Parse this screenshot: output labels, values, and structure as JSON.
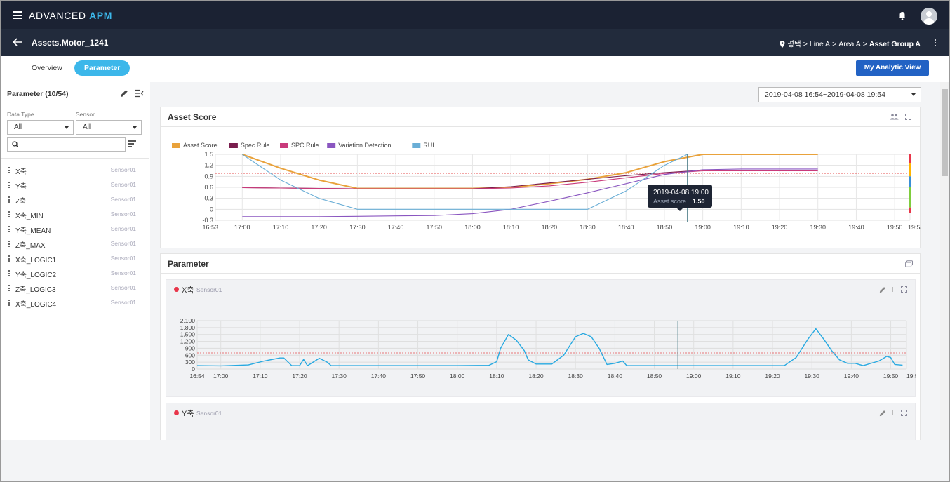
{
  "app": {
    "brand_main": "ADVANCED",
    "brand_accent": "APM",
    "accent_color": "#3cb7ea"
  },
  "header": {
    "asset_title": "Assets.Motor_1241",
    "breadcrumb": [
      "평택",
      "Line A",
      "Area A",
      "Asset Group A"
    ]
  },
  "tabs": {
    "overview": "Overview",
    "parameter": "Parameter",
    "active": "parameter"
  },
  "my_view_button": "My Analytic View",
  "sidebar": {
    "title": "Parameter (10/54)",
    "data_type_label": "Data Type",
    "data_type_value": "All",
    "sensor_label": "Sensor",
    "sensor_value": "All",
    "search_placeholder": "",
    "items": [
      {
        "name": "X축",
        "sensor": "Sensor01"
      },
      {
        "name": "Y축",
        "sensor": "Sensor01"
      },
      {
        "name": "Z축",
        "sensor": "Sensor01"
      },
      {
        "name": "X축_MIN",
        "sensor": "Sensor01"
      },
      {
        "name": "Y축_MEAN",
        "sensor": "Sensor01"
      },
      {
        "name": "Z축_MAX",
        "sensor": "Sensor01"
      },
      {
        "name": "X축_LOGIC1",
        "sensor": "Sensor01"
      },
      {
        "name": "Y축_LOGIC2",
        "sensor": "Sensor01"
      },
      {
        "name": "Z축_LOGIC3",
        "sensor": "Sensor01"
      },
      {
        "name": "X축_LOGIC4",
        "sensor": "Sensor01"
      }
    ]
  },
  "date_range": "2019-04-08 16:54~2019-04-08 19:54",
  "asset_score_panel": {
    "title": "Asset Score"
  },
  "parameter_panel": {
    "title": "Parameter",
    "cards": [
      {
        "name": "X축",
        "sensor": "Sensor01"
      },
      {
        "name": "Y축",
        "sensor": "Sensor01"
      }
    ]
  },
  "tooltip": {
    "time": "2019-04-08 19:00",
    "label": "Asset score",
    "value": "1.50"
  },
  "chart_data": [
    {
      "type": "line",
      "title": "Asset Score",
      "x": [
        "16:53",
        "17:00",
        "17:10",
        "17:20",
        "17:30",
        "17:40",
        "17:50",
        "18:00",
        "18:10",
        "18:20",
        "18:30",
        "18:40",
        "18:50",
        "19:00",
        "19:10",
        "19:20",
        "19:30",
        "19:40",
        "19:50",
        "19:54"
      ],
      "x_ticks": [
        "16:53",
        "17:00",
        "17:10",
        "17:20",
        "17:30",
        "17:40",
        "17:50",
        "18:00",
        "18:10",
        "18:20",
        "18:30",
        "18:40",
        "18:50",
        "19:00",
        "19:10",
        "19:20",
        "19:30",
        "19:40",
        "19:50",
        "19:54"
      ],
      "y_ticks": [
        "1.5",
        "1.2",
        "0.9",
        "0.6",
        "0.3",
        "0",
        "-0.3"
      ],
      "ylim": [
        -0.3,
        1.5
      ],
      "threshold": 0.98,
      "cursor_time": "18:56",
      "series": [
        {
          "name": "Asset Score",
          "color": "#e9a23b",
          "points": [
            [
              "17:00",
              1.5
            ],
            [
              "17:10",
              1.12
            ],
            [
              "17:20",
              0.8
            ],
            [
              "17:30",
              0.57
            ],
            [
              "17:40",
              0.57
            ],
            [
              "17:50",
              0.57
            ],
            [
              "18:00",
              0.57
            ],
            [
              "18:10",
              0.6
            ],
            [
              "18:20",
              0.7
            ],
            [
              "18:30",
              0.82
            ],
            [
              "18:40",
              1.0
            ],
            [
              "18:50",
              1.3
            ],
            [
              "19:00",
              1.5
            ],
            [
              "19:10",
              1.5
            ],
            [
              "19:20",
              1.5
            ],
            [
              "19:30",
              1.5
            ]
          ]
        },
        {
          "name": "Spec Rule",
          "color": "#7a1e4e",
          "points": [
            [
              "17:00",
              0.59
            ],
            [
              "17:10",
              0.58
            ],
            [
              "17:20",
              0.57
            ],
            [
              "17:30",
              0.56
            ],
            [
              "17:40",
              0.56
            ],
            [
              "17:50",
              0.56
            ],
            [
              "18:00",
              0.56
            ],
            [
              "18:10",
              0.62
            ],
            [
              "18:20",
              0.72
            ],
            [
              "18:30",
              0.82
            ],
            [
              "18:40",
              0.92
            ],
            [
              "18:50",
              1.0
            ],
            [
              "19:00",
              1.07
            ],
            [
              "19:10",
              1.07
            ],
            [
              "19:20",
              1.07
            ],
            [
              "19:30",
              1.07
            ]
          ]
        },
        {
          "name": "SPC Rule",
          "color": "#c93a7b",
          "points": [
            [
              "17:00",
              0.59
            ],
            [
              "17:10",
              0.58
            ],
            [
              "17:20",
              0.57
            ],
            [
              "17:30",
              0.56
            ],
            [
              "17:40",
              0.56
            ],
            [
              "17:50",
              0.56
            ],
            [
              "18:00",
              0.56
            ],
            [
              "18:10",
              0.58
            ],
            [
              "18:20",
              0.64
            ],
            [
              "18:30",
              0.74
            ],
            [
              "18:40",
              0.86
            ],
            [
              "18:50",
              0.98
            ],
            [
              "19:00",
              1.05
            ],
            [
              "19:10",
              1.05
            ],
            [
              "19:20",
              1.05
            ],
            [
              "19:30",
              1.05
            ]
          ]
        },
        {
          "name": "Variation Detection",
          "color": "#8a56c0",
          "points": [
            [
              "17:00",
              -0.2
            ],
            [
              "17:10",
              -0.2
            ],
            [
              "17:20",
              -0.2
            ],
            [
              "17:30",
              -0.19
            ],
            [
              "17:40",
              -0.18
            ],
            [
              "17:50",
              -0.17
            ],
            [
              "18:00",
              -0.12
            ],
            [
              "18:10",
              0.0
            ],
            [
              "18:20",
              0.22
            ],
            [
              "18:30",
              0.45
            ],
            [
              "18:40",
              0.7
            ],
            [
              "18:50",
              0.95
            ],
            [
              "19:00",
              1.08
            ],
            [
              "19:10",
              1.1
            ],
            [
              "19:20",
              1.1
            ],
            [
              "19:30",
              1.1
            ]
          ]
        },
        {
          "name": "RUL",
          "color": "#6aaed6",
          "points": [
            [
              "17:00",
              1.5
            ],
            [
              "17:10",
              0.8
            ],
            [
              "17:20",
              0.3
            ],
            [
              "17:30",
              0.0
            ],
            [
              "17:40",
              0.0
            ],
            [
              "17:50",
              0.0
            ],
            [
              "18:00",
              0.0
            ],
            [
              "18:10",
              0.0
            ],
            [
              "18:20",
              0.0
            ],
            [
              "18:30",
              0.0
            ],
            [
              "18:40",
              0.5
            ],
            [
              "18:50",
              1.2
            ],
            [
              "18:56",
              1.5
            ]
          ]
        }
      ]
    },
    {
      "type": "line",
      "title": "X축",
      "x_ticks": [
        "16:54",
        "17:00",
        "17:10",
        "17:20",
        "17:30",
        "17:40",
        "17:50",
        "18:00",
        "18:10",
        "18:20",
        "18:30",
        "18:40",
        "18:50",
        "19:00",
        "19:10",
        "19:20",
        "19:30",
        "19:40",
        "19:50",
        "19:54"
      ],
      "y_ticks": [
        "2,100",
        "1,800",
        "1,500",
        "1,200",
        "900",
        "600",
        "300",
        "0"
      ],
      "ylim": [
        0,
        2100
      ],
      "threshold": 700,
      "cursor_time": "18:56",
      "series": [
        {
          "name": "X축",
          "color": "#27a9e1",
          "points": [
            [
              "16:54",
              150
            ],
            [
              "17:00",
              140
            ],
            [
              "17:07",
              180
            ],
            [
              "17:11",
              350
            ],
            [
              "17:15",
              480
            ],
            [
              "17:16",
              480
            ],
            [
              "17:18",
              150
            ],
            [
              "17:20",
              150
            ],
            [
              "17:21",
              420
            ],
            [
              "17:22",
              150
            ],
            [
              "17:25",
              470
            ],
            [
              "17:27",
              300
            ],
            [
              "17:28",
              150
            ],
            [
              "17:40",
              150
            ],
            [
              "17:55",
              150
            ],
            [
              "18:00",
              150
            ],
            [
              "18:08",
              160
            ],
            [
              "18:10",
              320
            ],
            [
              "18:11",
              900
            ],
            [
              "18:13",
              1500
            ],
            [
              "18:15",
              1250
            ],
            [
              "18:17",
              800
            ],
            [
              "18:18",
              400
            ],
            [
              "18:20",
              220
            ],
            [
              "18:24",
              220
            ],
            [
              "18:27",
              600
            ],
            [
              "18:30",
              1400
            ],
            [
              "18:32",
              1550
            ],
            [
              "18:34",
              1400
            ],
            [
              "18:36",
              900
            ],
            [
              "18:37",
              550
            ],
            [
              "18:38",
              200
            ],
            [
              "18:40",
              250
            ],
            [
              "18:42",
              350
            ],
            [
              "18:43",
              150
            ],
            [
              "18:50",
              150
            ],
            [
              "19:00",
              150
            ],
            [
              "19:10",
              150
            ],
            [
              "19:20",
              150
            ],
            [
              "19:23",
              150
            ],
            [
              "19:26",
              500
            ],
            [
              "19:29",
              1300
            ],
            [
              "19:31",
              1750
            ],
            [
              "19:33",
              1300
            ],
            [
              "19:35",
              800
            ],
            [
              "19:37",
              400
            ],
            [
              "19:39",
              250
            ],
            [
              "19:41",
              250
            ],
            [
              "19:43",
              150
            ],
            [
              "19:47",
              350
            ],
            [
              "19:49",
              550
            ],
            [
              "19:50",
              500
            ],
            [
              "19:51",
              200
            ],
            [
              "19:53",
              170
            ]
          ]
        }
      ]
    }
  ]
}
